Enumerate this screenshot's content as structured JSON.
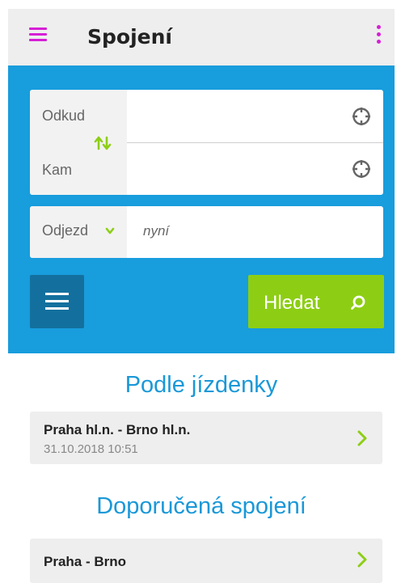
{
  "appbar": {
    "title": "Spojení",
    "accent_color": "#d61fd6",
    "menu_icon": "hamburger-icon",
    "overflow_icon": "more-vert-icon"
  },
  "search": {
    "background_color": "#189ddd",
    "from_label": "Odkud",
    "from_value": "",
    "to_label": "Kam",
    "to_value": "",
    "swap_icon": "swap-icon",
    "location_icon": "locate-icon",
    "time_mode_label": "Odjezd",
    "time_value": "nyní",
    "options_icon": "menu-icon",
    "search_button_label": "Hledat",
    "search_button_color": "#8dce14",
    "search_icon": "search-icon"
  },
  "ticket_section": {
    "title": "Podle jízdenky",
    "items": [
      {
        "route": "Praha hl.n. - Brno hl.n.",
        "datetime": "31.10.2018 10:51"
      }
    ]
  },
  "recommended_section": {
    "title": "Doporučená spojení",
    "items": [
      {
        "route": "Praha - Brno"
      }
    ]
  }
}
